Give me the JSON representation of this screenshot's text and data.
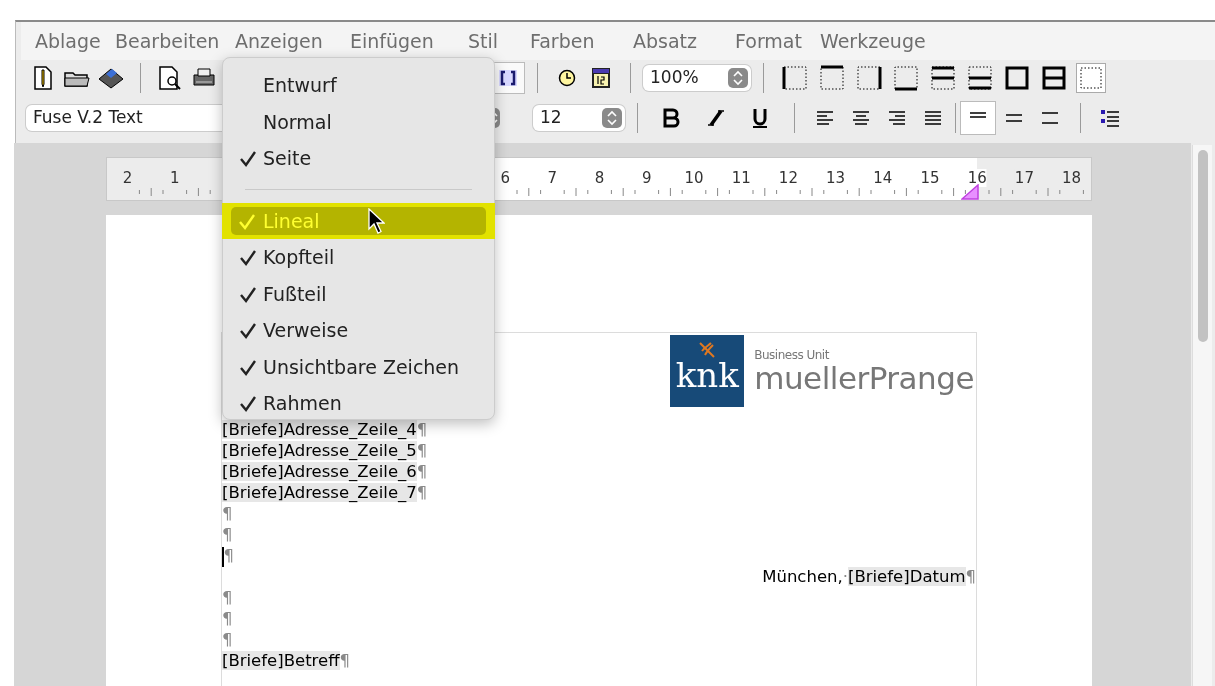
{
  "menu_bar": [
    {
      "label": "Ablage"
    },
    {
      "label": "Bearbeiten"
    },
    {
      "label": "Anzeigen"
    },
    {
      "label": "Einfügen"
    },
    {
      "label": "Stil"
    },
    {
      "label": "Farben"
    },
    {
      "label": "Absatz"
    },
    {
      "label": "Format"
    },
    {
      "label": "Werkzeuge"
    }
  ],
  "toolbar": {
    "zoom": "100%",
    "font": "Fuse V.2 Text",
    "size": "12",
    "border_buttons": [
      {
        "selected": false
      },
      {
        "selected": false
      },
      {
        "selected": false
      },
      {
        "selected": false
      },
      {
        "selected": false
      },
      {
        "selected": false
      },
      {
        "selected": false
      },
      {
        "selected": false
      },
      {
        "selected": true
      }
    ],
    "spacing_buttons": [
      {
        "selected": true
      },
      {
        "selected": false
      },
      {
        "selected": false
      }
    ]
  },
  "dropdown_menu": [
    {
      "kind": "item",
      "label": "Entwurf",
      "checked": false,
      "selected": false
    },
    {
      "kind": "item",
      "label": "Normal",
      "checked": false,
      "selected": false
    },
    {
      "kind": "item",
      "label": "Seite",
      "checked": true,
      "selected": false
    },
    {
      "kind": "separator"
    },
    {
      "kind": "item",
      "label": "Lineal",
      "checked": true,
      "selected": true
    },
    {
      "kind": "item",
      "label": "Kopfteil",
      "checked": true,
      "selected": false
    },
    {
      "kind": "item",
      "label": "Fußteil",
      "checked": true,
      "selected": false
    },
    {
      "kind": "item",
      "label": "Verweise",
      "checked": true,
      "selected": false
    },
    {
      "kind": "item",
      "label": "Unsichtbare Zeichen",
      "checked": true,
      "selected": false
    },
    {
      "kind": "item",
      "label": "Rahmen",
      "checked": true,
      "selected": false
    }
  ],
  "ruler": {
    "left_labels": [
      "2",
      "1"
    ],
    "right_labels": [
      "6",
      "7",
      "8",
      "9",
      "10",
      "11",
      "12",
      "13",
      "14",
      "15",
      "16",
      "17",
      "18"
    ]
  },
  "logo": {
    "mark": "knk",
    "subtitle": "Business Unit",
    "name": "muellerPrange"
  },
  "document": [
    {
      "right_aligned": false,
      "cursor": false,
      "runs": [
        {
          "kind": "field",
          "text": "[Briefe]Adresse_Zeile_4"
        },
        {
          "kind": "mark",
          "text": "¶"
        }
      ]
    },
    {
      "right_aligned": false,
      "cursor": false,
      "runs": [
        {
          "kind": "field",
          "text": "[Briefe]Adresse_Zeile_5"
        },
        {
          "kind": "mark",
          "text": "¶"
        }
      ]
    },
    {
      "right_aligned": false,
      "cursor": false,
      "runs": [
        {
          "kind": "field",
          "text": "[Briefe]Adresse_Zeile_6"
        },
        {
          "kind": "mark",
          "text": "¶"
        }
      ]
    },
    {
      "right_aligned": false,
      "cursor": false,
      "runs": [
        {
          "kind": "field",
          "text": "[Briefe]Adresse_Zeile_7"
        },
        {
          "kind": "mark",
          "text": "¶"
        }
      ]
    },
    {
      "right_aligned": false,
      "cursor": false,
      "runs": [
        {
          "kind": "mark",
          "text": "¶"
        }
      ]
    },
    {
      "right_aligned": false,
      "cursor": false,
      "runs": [
        {
          "kind": "mark",
          "text": "¶"
        }
      ]
    },
    {
      "right_aligned": false,
      "cursor": true,
      "runs": [
        {
          "kind": "mark",
          "text": "¶"
        }
      ]
    },
    {
      "right_aligned": true,
      "cursor": false,
      "runs": [
        {
          "kind": "text",
          "text": "München,"
        },
        {
          "kind": "mark",
          "text": "·"
        },
        {
          "kind": "field",
          "text": "[Briefe]Datum"
        },
        {
          "kind": "mark",
          "text": "¶"
        }
      ]
    },
    {
      "right_aligned": false,
      "cursor": false,
      "runs": [
        {
          "kind": "mark",
          "text": "¶"
        }
      ]
    },
    {
      "right_aligned": false,
      "cursor": false,
      "runs": [
        {
          "kind": "mark",
          "text": "¶"
        }
      ]
    },
    {
      "right_aligned": false,
      "cursor": false,
      "runs": [
        {
          "kind": "mark",
          "text": "¶"
        }
      ]
    },
    {
      "right_aligned": false,
      "cursor": false,
      "runs": [
        {
          "kind": "field",
          "text": "[Briefe]Betreff"
        },
        {
          "kind": "mark",
          "text": "¶"
        }
      ]
    }
  ]
}
